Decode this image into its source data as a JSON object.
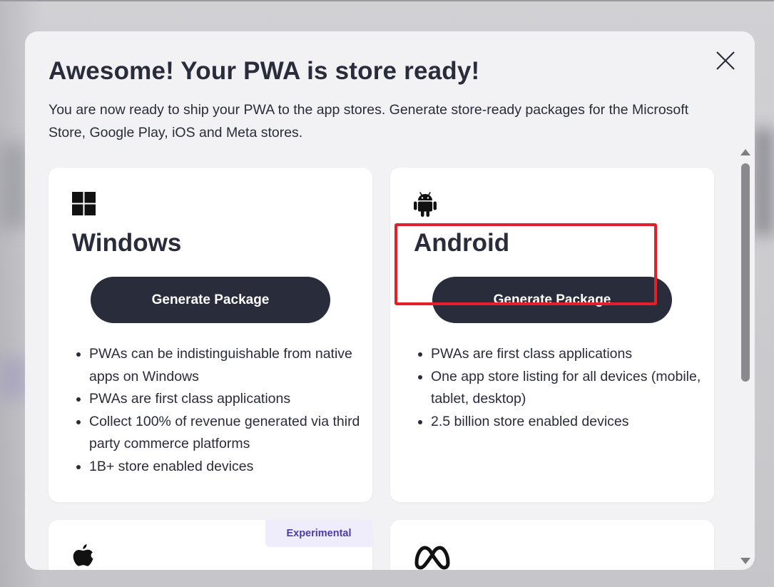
{
  "modal": {
    "title": "Awesome! Your PWA is store ready!",
    "subtitle": "You are now ready to ship your PWA to the app stores. Generate store-ready packages for the Microsoft Store, Google Play, iOS and Meta stores.",
    "close_icon": "close-icon"
  },
  "cards": {
    "windows": {
      "icon": "windows-logo-icon",
      "title": "Windows",
      "button_label": "Generate Package",
      "features": [
        "PWAs can be indistinguishable from native apps on Windows",
        "PWAs are first class applications",
        "Collect 100% of revenue generated via third party commerce platforms",
        "1B+ store enabled devices"
      ]
    },
    "android": {
      "icon": "android-logo-icon",
      "title": "Android",
      "button_label": "Generate Package",
      "features": [
        "PWAs are first class applications",
        "One app store listing for all devices (mobile, tablet, desktop)",
        "2.5 billion store enabled devices"
      ]
    },
    "ios": {
      "icon": "apple-logo-icon",
      "badge": "Experimental"
    },
    "meta": {
      "icon": "meta-logo-icon"
    }
  },
  "colors": {
    "primary_button": "#292c3a",
    "highlight": "#e3202a",
    "badge_bg": "#efedfb",
    "badge_text": "#4a3ea7"
  }
}
